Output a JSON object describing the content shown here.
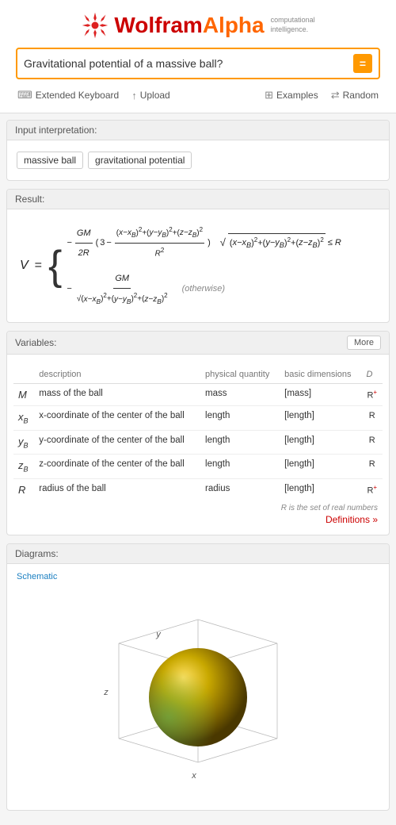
{
  "header": {
    "logo_wolfram": "Wolfram",
    "logo_alpha": "Alpha",
    "logo_tagline_line1": "computational",
    "logo_tagline_line2": "intelligence.",
    "search_value": "Gravitational potential of a massive ball?",
    "search_placeholder": "Gravitational potential of a massive ball?"
  },
  "toolbar": {
    "extended_keyboard_label": "Extended Keyboard",
    "upload_label": "Upload",
    "examples_label": "Examples",
    "random_label": "Random"
  },
  "input_interpretation": {
    "section_label": "Input interpretation:",
    "tags": [
      "massive ball",
      "gravitational potential"
    ]
  },
  "result": {
    "section_label": "Result:",
    "otherwise_label": "(otherwise)"
  },
  "variables": {
    "section_label": "Variables:",
    "more_button": "More",
    "columns": [
      "description",
      "physical quantity",
      "basic dimensions",
      "D"
    ],
    "rows": [
      {
        "symbol": "M",
        "description": "mass of the ball",
        "physical_quantity": "mass",
        "basic_dimensions": "[mass]",
        "domain": "R",
        "domain_sup": "+"
      },
      {
        "symbol": "x_B",
        "description": "x-coordinate of the center of the ball",
        "physical_quantity": "length",
        "basic_dimensions": "[length]",
        "domain": "R",
        "domain_sup": ""
      },
      {
        "symbol": "y_B",
        "description": "y-coordinate of the center of the ball",
        "physical_quantity": "length",
        "basic_dimensions": "[length]",
        "domain": "R",
        "domain_sup": ""
      },
      {
        "symbol": "z_B",
        "description": "z-coordinate of the center of the ball",
        "physical_quantity": "length",
        "basic_dimensions": "[length]",
        "domain": "R",
        "domain_sup": ""
      },
      {
        "symbol": "R",
        "description": "radius of the ball",
        "physical_quantity": "radius",
        "basic_dimensions": "[length]",
        "domain": "R",
        "domain_sup": "+"
      }
    ],
    "footnote": "R is the set of real numbers",
    "definitions_link": "Definitions »"
  },
  "diagrams": {
    "section_label": "Diagrams:",
    "schematic_label": "Schematic"
  }
}
